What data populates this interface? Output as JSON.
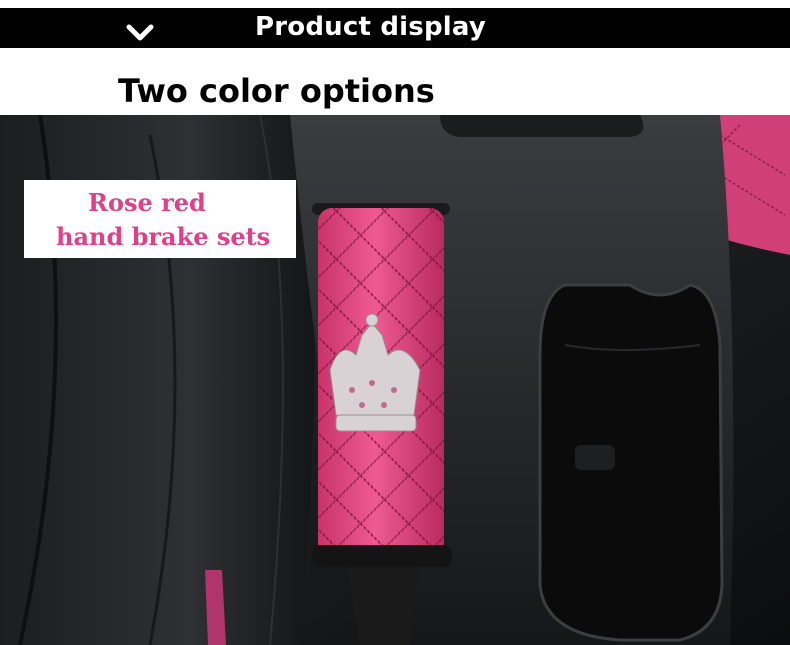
{
  "header": {
    "title": "Product display",
    "icon": "chevron-down-icon"
  },
  "subtitle": "Two color options",
  "label": {
    "line1": "Rose red",
    "line2": "hand brake sets"
  },
  "colors": {
    "accent": "#e0408a",
    "cover": "#e8457f",
    "bar": "#000000"
  }
}
